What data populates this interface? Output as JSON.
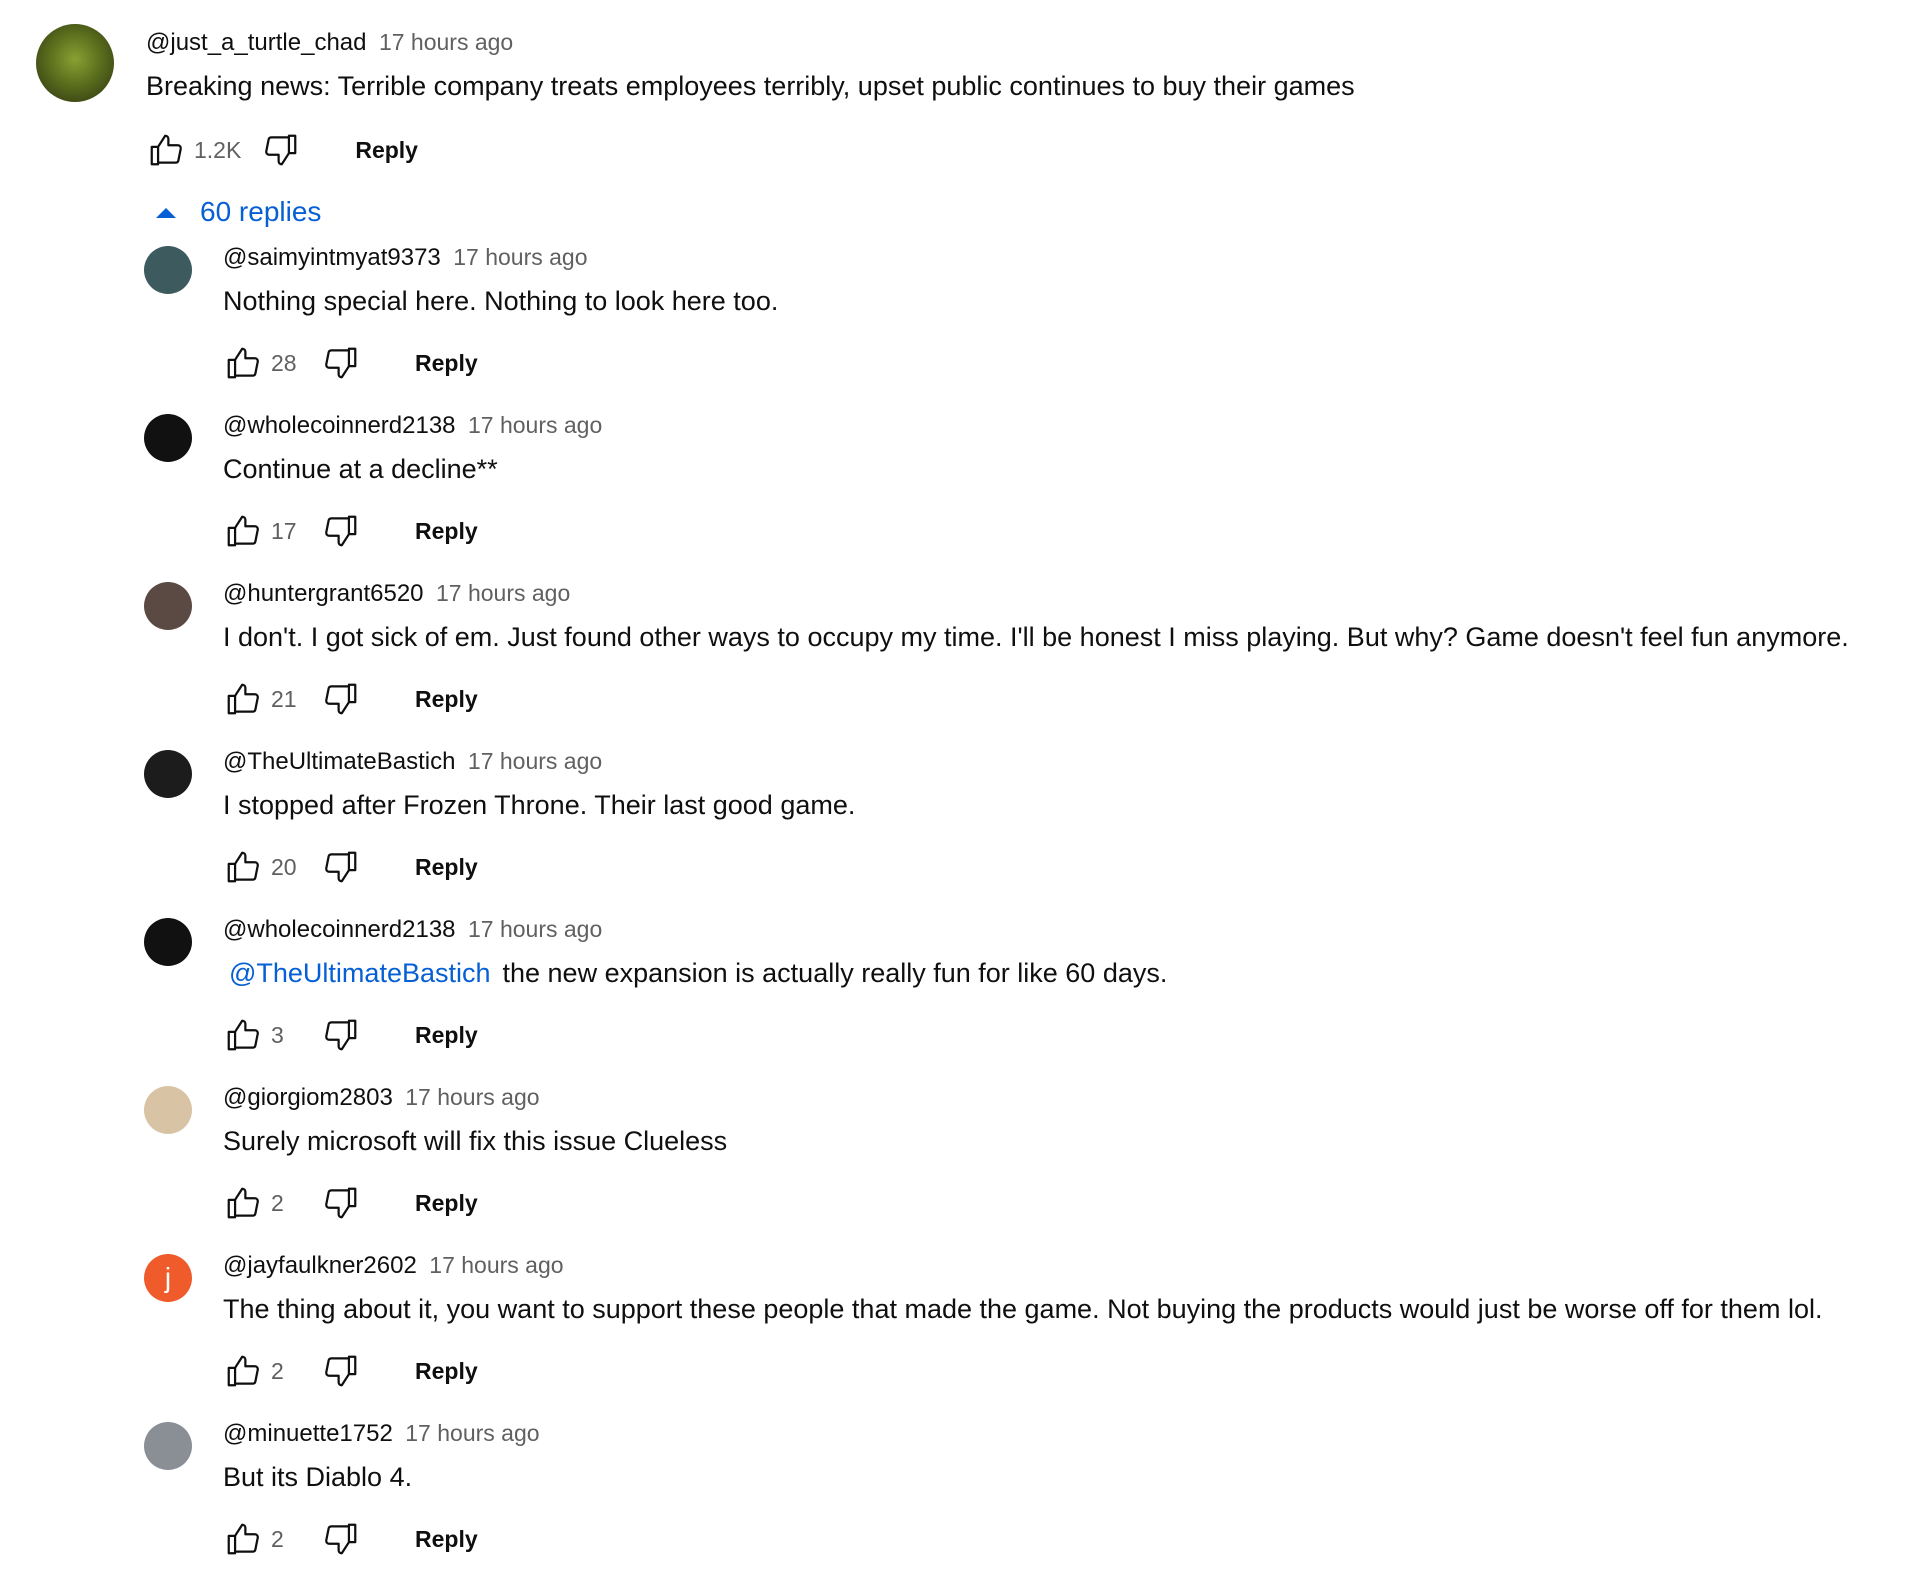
{
  "top_comment": {
    "author": "@just_a_turtle_chad",
    "time": "17 hours ago",
    "text": "Breaking news: Terrible company treats employees terribly, upset public continues to buy their games",
    "likes": "1.2K",
    "reply_label": "Reply",
    "avatar_color": "#4a5d1e",
    "replies_toggle": "60 replies"
  },
  "replies": [
    {
      "author": "@saimyintmyat9373",
      "time": "17 hours ago",
      "text": "Nothing special here. Nothing to look here too.",
      "mention": "",
      "likes": "28",
      "reply_label": "Reply",
      "avatar_color": "#3d5a5e"
    },
    {
      "author": "@wholecoinnerd2138",
      "time": "17 hours ago",
      "text": "Continue at a decline**",
      "mention": "",
      "likes": "17",
      "reply_label": "Reply",
      "avatar_color": "#111111"
    },
    {
      "author": "@huntergrant6520",
      "time": "17 hours ago",
      "text": "I don't. I got sick of em. Just found other ways to occupy my time. I'll be honest I miss playing. But why? Game doesn't feel fun anymore.",
      "mention": "",
      "likes": "21",
      "reply_label": "Reply",
      "avatar_color": "#5b4a44"
    },
    {
      "author": "@TheUltimateBastich",
      "time": "17 hours ago",
      "text": "I stopped after Frozen Throne. Their last good game.",
      "mention": "",
      "likes": "20",
      "reply_label": "Reply",
      "avatar_color": "#1c1c1c"
    },
    {
      "author": "@wholecoinnerd2138",
      "time": "17 hours ago",
      "text": "the new expansion is actually really fun for like 60 days.",
      "mention": "@TheUltimateBastich",
      "likes": "3",
      "reply_label": "Reply",
      "avatar_color": "#111111"
    },
    {
      "author": "@giorgiom2803",
      "time": "17 hours ago",
      "text": "Surely microsoft will fix this issue Clueless",
      "mention": "",
      "likes": "2",
      "reply_label": "Reply",
      "avatar_color": "#d9c3a5"
    },
    {
      "author": "@jayfaulkner2602",
      "time": "17 hours ago",
      "text": "The thing about it, you want to support these people that made the game. Not buying the products would just be worse off for them lol.",
      "mention": "",
      "likes": "2",
      "reply_label": "Reply",
      "avatar_color": "#ef5b2b",
      "avatar_letter": "j"
    },
    {
      "author": "@minuette1752",
      "time": "17 hours ago",
      "text": "But its Diablo 4.",
      "mention": "",
      "likes": "2",
      "reply_label": "Reply",
      "avatar_color": "#8a8f95"
    }
  ],
  "icons": {
    "like": "thumbs-up-icon",
    "dislike": "thumbs-down-icon",
    "collapse": "caret-up-icon"
  },
  "colors": {
    "link": "#065fd4",
    "secondary_text": "#606060",
    "primary_text": "#0f0f0f"
  }
}
